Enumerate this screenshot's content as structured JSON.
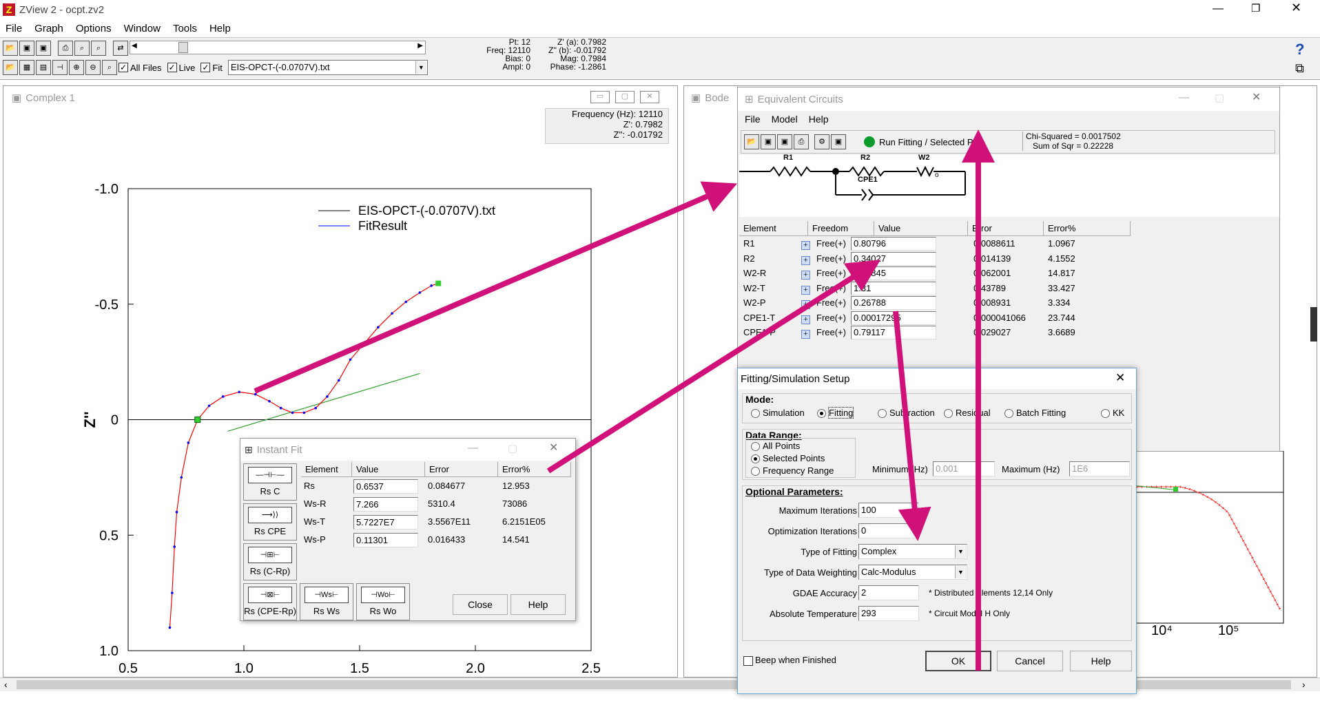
{
  "app": {
    "title": "ZView 2 - ocpt.zv2",
    "menu": [
      "File",
      "Graph",
      "Options",
      "Window",
      "Tools",
      "Help"
    ]
  },
  "toolbar": {
    "all_files": "All Files",
    "live": "Live",
    "fit": "Fit",
    "file_select": "EIS-OPCT-(-0.0707V).txt",
    "readout": {
      "pt": "Pt: 12",
      "freq": "Freq: 12110",
      "bias": "Bias: 0",
      "ampl": "Ampl: 0",
      "za": "Z' (a): 0.7982",
      "zb": "Z'' (b): -0.01792",
      "mag": "Mag: 0.7984",
      "phase": "Phase: -1.2861"
    }
  },
  "complex": {
    "title": "Complex 1",
    "info": [
      "Frequency (Hz): 12110",
      "Z': 0.7982",
      "Z'': -0.01792"
    ],
    "legend": [
      "EIS-OPCT-(-0.0707V).txt",
      "FitResult"
    ]
  },
  "chart_data": {
    "type": "line",
    "title": "",
    "xlabel": "",
    "ylabel": "Z''",
    "xlim": [
      0.5,
      2.5
    ],
    "ylim": [
      -1.0,
      1.0
    ],
    "y_inverted": true,
    "x_ticks": [
      "0.5",
      "1.0",
      "1.5",
      "2.0",
      "2.5"
    ],
    "y_ticks": [
      "-1.0",
      "-0.5",
      "0",
      "0.5",
      "1.0"
    ],
    "series": [
      {
        "name": "EIS-OPCT-(-0.0707V).txt",
        "color": "#0000ff",
        "x": [
          0.68,
          0.69,
          0.7,
          0.71,
          0.73,
          0.76,
          0.8,
          0.85,
          0.91,
          0.98,
          1.05,
          1.11,
          1.16,
          1.21,
          1.26,
          1.31,
          1.36,
          1.41,
          1.46,
          1.52,
          1.58,
          1.64,
          1.7,
          1.76,
          1.81,
          1.84
        ],
        "y": [
          0.9,
          0.75,
          0.55,
          0.4,
          0.25,
          0.1,
          0.0,
          -0.06,
          -0.1,
          -0.12,
          -0.11,
          -0.08,
          -0.05,
          -0.03,
          -0.03,
          -0.05,
          -0.1,
          -0.17,
          -0.26,
          -0.33,
          -0.4,
          -0.46,
          -0.51,
          -0.55,
          -0.58,
          -0.59
        ]
      },
      {
        "name": "FitResult",
        "color": "#ff0000",
        "x": [
          0.68,
          0.69,
          0.7,
          0.71,
          0.73,
          0.76,
          0.8,
          0.85,
          0.91,
          0.98,
          1.05,
          1.11,
          1.16,
          1.21,
          1.26,
          1.31,
          1.36,
          1.41,
          1.46,
          1.52,
          1.58,
          1.64,
          1.7,
          1.76,
          1.81,
          1.84
        ],
        "y": [
          0.9,
          0.75,
          0.55,
          0.4,
          0.25,
          0.1,
          0.0,
          -0.06,
          -0.1,
          -0.12,
          -0.11,
          -0.08,
          -0.05,
          -0.03,
          -0.03,
          -0.05,
          -0.1,
          -0.17,
          -0.26,
          -0.33,
          -0.4,
          -0.46,
          -0.51,
          -0.55,
          -0.58,
          -0.59
        ]
      },
      {
        "name": "",
        "color": "#2e9e2e",
        "x": [
          0.93,
          1.76
        ],
        "y": [
          0.05,
          -0.2
        ]
      }
    ]
  },
  "bode": {
    "title": "Bode",
    "x_ticks": [
      "10⁴",
      "10⁵"
    ]
  },
  "equiv": {
    "title": "Equivalent Circuits",
    "menu": [
      "File",
      "Model",
      "Help"
    ],
    "run_fitting": "Run Fitting / Selected Pts.",
    "chi": "Chi-Squared = 0.0017502",
    "sumsqr": "Sum of Sqr = 0.22228",
    "circuit": {
      "r1": "R1",
      "r2": "R2",
      "w2": "W2",
      "w2sub": "o",
      "cpe1": "CPE1"
    },
    "headers": [
      "Element",
      "Freedom",
      "Value",
      "Error",
      "Error%"
    ],
    "rows": [
      {
        "el": "R1",
        "free": "Free(+)",
        "val": "0.80796",
        "err": "0.0088611",
        "pct": "1.0967"
      },
      {
        "el": "R2",
        "free": "Free(+)",
        "val": "0.34027",
        "err": "0.014139",
        "pct": "4.1552"
      },
      {
        "el": "W2-R",
        "free": "Free(+)",
        "val": "0.41845",
        "err": "0.062001",
        "pct": "14.817"
      },
      {
        "el": "W2-T",
        "free": "Free(+)",
        "val": "1.31",
        "err": "0.43789",
        "pct": "33.427"
      },
      {
        "el": "W2-P",
        "free": "Free(+)",
        "val": "0.26788",
        "err": "0.008931",
        "pct": "3.334"
      },
      {
        "el": "CPE1-T",
        "free": "Free(+)",
        "val": "0.00017295",
        "err": "0.000041066",
        "pct": "23.744"
      },
      {
        "el": "CPE1-P",
        "free": "Free(+)",
        "val": "0.79117",
        "err": "0.029027",
        "pct": "3.6689"
      }
    ]
  },
  "instant": {
    "title": "Instant Fit",
    "models": [
      "Rs C",
      "Rs CPE",
      "Rs (C-Rp)",
      "Rs (CPE-Rp)",
      "Rs Ws",
      "Rs Wo"
    ],
    "headers": [
      "Element",
      "Value",
      "Error",
      "Error%"
    ],
    "rows": [
      {
        "el": "Rs",
        "val": "0.6537",
        "err": "0.084677",
        "pct": "12.953"
      },
      {
        "el": "Ws-R",
        "val": "7.266",
        "err": "5310.4",
        "pct": "73086"
      },
      {
        "el": "Ws-T",
        "val": "5.7227E7",
        "err": "3.5567E11",
        "pct": "6.2151E05"
      },
      {
        "el": "Ws-P",
        "val": "0.11301",
        "err": "0.016433",
        "pct": "14.541"
      }
    ],
    "close": "Close",
    "help": "Help"
  },
  "setup": {
    "title": "Fitting/Simulation Setup",
    "mode_label": "Mode:",
    "modes": [
      "Simulation",
      "Fitting",
      "Subtraction",
      "Residual",
      "Batch Fitting",
      "KK"
    ],
    "range_label": "Data Range:",
    "ranges": [
      "All Points",
      "Selected Points",
      "Frequency Range"
    ],
    "min_label": "Minimum (Hz)",
    "min_val": "0.001",
    "max_label": "Maximum (Hz)",
    "max_val": "1E6",
    "opt_label": "Optional Parameters:",
    "max_iter_label": "Maximum Iterations",
    "max_iter": "100",
    "opt_iter_label": "Optimization Iterations",
    "opt_iter": "0",
    "type_fit_label": "Type of Fitting",
    "type_fit": "Complex",
    "weight_label": "Type of Data Weighting",
    "weight": "Calc-Modulus",
    "gdae_label": "GDAE Accuracy",
    "gdae": "2",
    "gdae_note": "* Distributed Elements 12,14 Only",
    "temp_label": "Absolute Temperature",
    "temp": "293",
    "temp_note": "* Circuit Model H Only",
    "beep": "Beep when Finished",
    "ok": "OK",
    "cancel": "Cancel",
    "help": "Help"
  },
  "colors": {
    "arrow": "#d1117a",
    "accent": "#0000ff"
  }
}
